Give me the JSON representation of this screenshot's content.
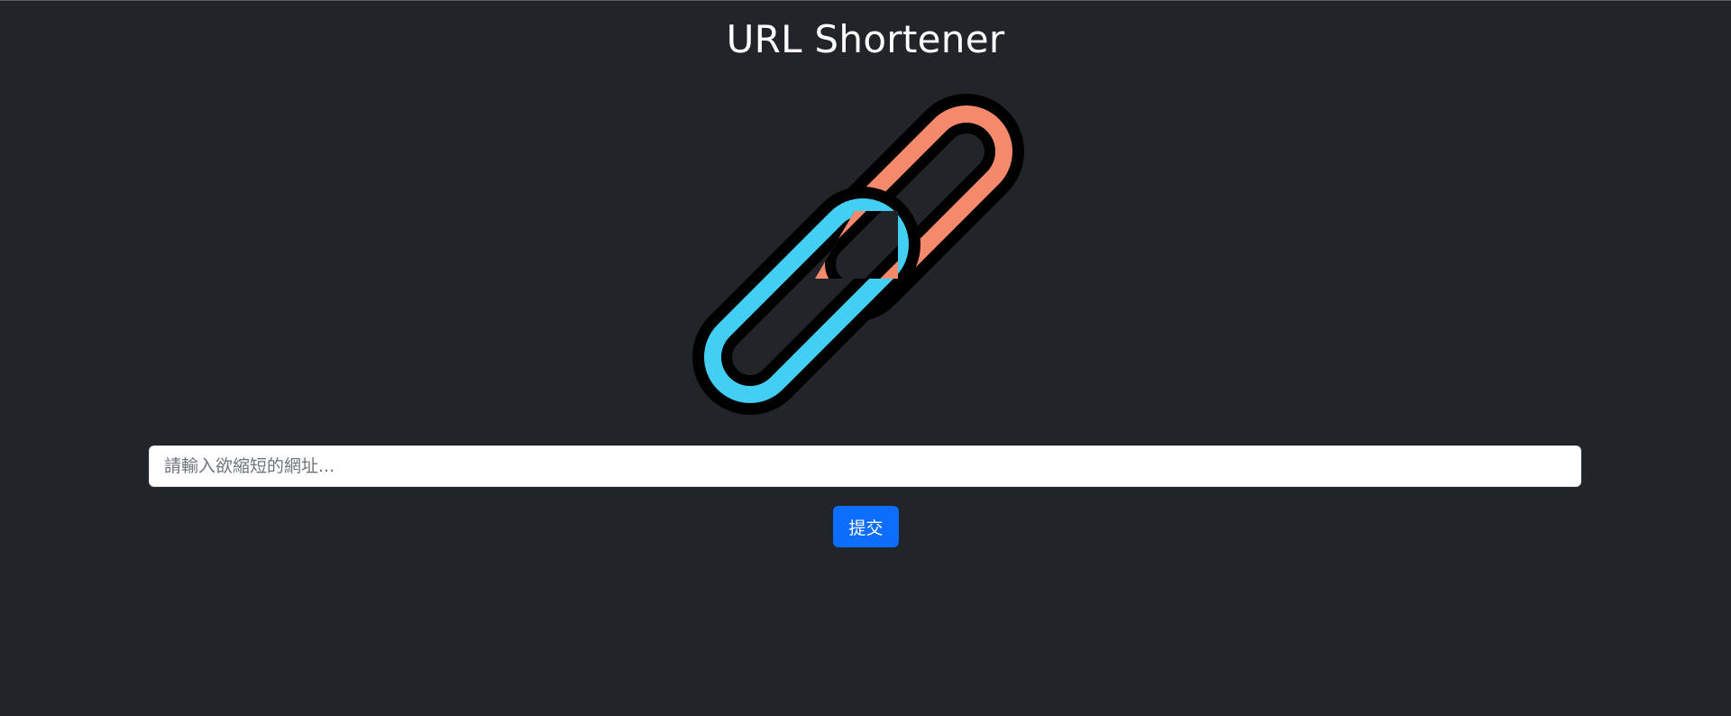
{
  "page": {
    "title": "URL Shortener",
    "background_color": "#212529"
  },
  "logo": {
    "icon": "chain-link-icon",
    "colors": {
      "link_left": "#43CFF4",
      "link_right": "#F48A6B",
      "outline": "#000000"
    }
  },
  "form": {
    "url_input": {
      "placeholder": "請輸入欲縮短的網址...",
      "value": ""
    },
    "submit_label": "提交",
    "submit_color": "#0d6efd"
  }
}
